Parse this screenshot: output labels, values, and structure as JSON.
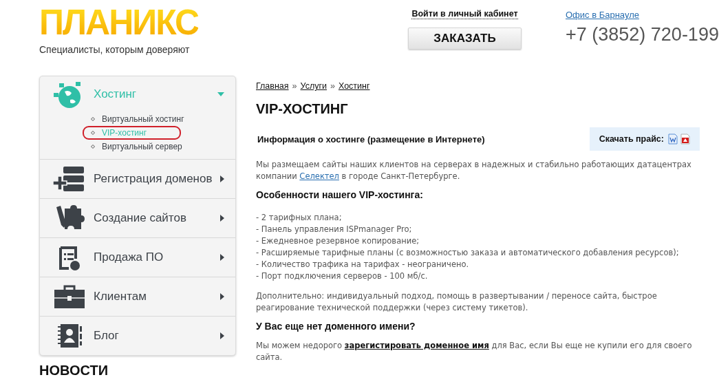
{
  "header": {
    "logo": "ПЛАНИКС",
    "tagline": "Специалисты, которым доверяют",
    "login_link": "Войти в личный кабинет",
    "order_button": "ЗАКАЗАТЬ",
    "office_link": "Офис в Барнауле",
    "phone": "+7 (3852) 720-199"
  },
  "sidebar": {
    "items": [
      {
        "label": "Хостинг",
        "expanded": true,
        "children": [
          {
            "label": "Виртуальный хостинг",
            "selected": false
          },
          {
            "label": "VIP-хостинг",
            "selected": true
          },
          {
            "label": "Виртуальный сервер",
            "selected": false
          }
        ]
      },
      {
        "label": "Регистрация доменов",
        "expanded": false
      },
      {
        "label": "Создание сайтов",
        "expanded": false
      },
      {
        "label": "Продажа ПО",
        "expanded": false
      },
      {
        "label": "Клиентам",
        "expanded": false
      },
      {
        "label": "Блог",
        "expanded": false
      }
    ],
    "news_heading": "НОВОСТИ"
  },
  "breadcrumb": [
    "Главная",
    "Услуги",
    "Хостинг"
  ],
  "breadcrumb_separator": "»",
  "title": "VIP-ХОСТИНГ",
  "info_heading": "Информация о хостинге (размещение в Интернете)",
  "price_label": "Скачать прайс:",
  "intro": {
    "before": "Мы размещаем сайты наших клиентов на серверах в надежных и стабильно работающих датацентрах компании",
    "link": "Селектел",
    "after": "в городе Санкт-Петербурге."
  },
  "features_heading": "**Особенности нашего VIP-хостинга**:",
  "features": [
    "- 2 тарифных плана;",
    "- Панель управления ISPmanager Pro;",
    "- Ежедневное резервное копирование;",
    "- Расширяемые тарифные планы (с возможностью заказа и автоматического добавления ресурсов);",
    "- Количество трафика на тарифах - неограничено.",
    "- Порт подключения серверов - 100 мб/с."
  ],
  "additional": "Дополнительно: индивидуальный подход, помощь в развертывании / переносе сайта, быстрое реагирование технической поддержки (через систему тикетов).",
  "domain_heading": "У Вас еще нет доменного имени?",
  "domain_text": {
    "before": "Мы можем недорого",
    "link": "зарегистировать доменное имя",
    "after": "для Вас, если Вы еще не купили его для своего сайта."
  }
}
